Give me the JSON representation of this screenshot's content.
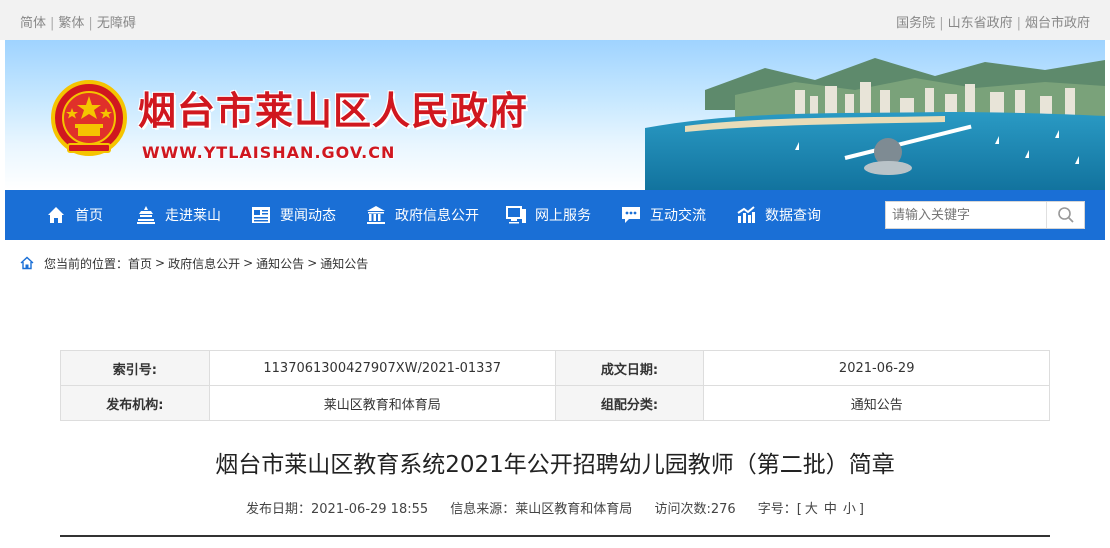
{
  "topbar": {
    "left_links": [
      "简体",
      "繁体",
      "无障碍"
    ],
    "right_links": [
      "国务院",
      "山东省政府",
      "烟台市政府"
    ]
  },
  "banner": {
    "site_title": "烟台市莱山区人民政府",
    "site_url": "WWW.YTLAISHAN.GOV.CN"
  },
  "nav": {
    "items": [
      {
        "label": "首页",
        "icon": "home-icon"
      },
      {
        "label": "走进莱山",
        "icon": "landmark-icon"
      },
      {
        "label": "要闻动态",
        "icon": "news-icon"
      },
      {
        "label": "政府信息公开",
        "icon": "government-building-icon"
      },
      {
        "label": "网上服务",
        "icon": "computer-icon"
      },
      {
        "label": "互动交流",
        "icon": "chat-icon"
      },
      {
        "label": "数据查询",
        "icon": "chart-icon"
      }
    ],
    "search_placeholder": "请输入关键字"
  },
  "breadcrumb": {
    "prefix": "您当前的位置：",
    "items": [
      "首页",
      "政府信息公开",
      "通知公告",
      "通知公告"
    ]
  },
  "info": {
    "index_label": "索引号:",
    "index_value": "1137061300427907XW/2021-01337",
    "date_label": "成文日期:",
    "date_value": "2021-06-29",
    "publisher_label": "发布机构:",
    "publisher_value": "莱山区教育和体育局",
    "category_label": "组配分类:",
    "category_value": "通知公告"
  },
  "article": {
    "title": "烟台市莱山区教育系统2021年公开招聘幼儿园教师（第二批）简章",
    "publish_date": "发布日期：2021-06-29 18:55",
    "source": "信息来源：莱山区教育和体育局",
    "views": "访问次数:276",
    "font_size_label": "字号：[",
    "font_sizes": [
      "大",
      "中",
      "小"
    ],
    "font_size_end": "]"
  },
  "colors": {
    "nav_bg": "#1a6fd6",
    "title_red": "#d0171f"
  }
}
